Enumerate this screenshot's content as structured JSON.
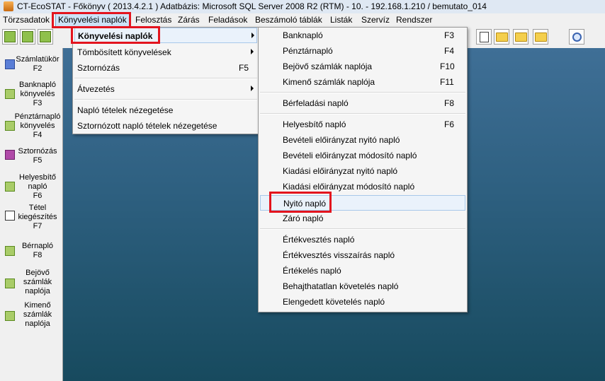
{
  "window": {
    "title": "CT-EcoSTAT - Főkönyv ( 2013.4.2.1 ) Adatbázis: Microsoft SQL Server 2008 R2 (RTM) - 10. - 192.168.1.210 / bemutato_014"
  },
  "menubar": {
    "items": [
      {
        "label": "Törzsadatok"
      },
      {
        "label": "Könyvelési naplók"
      },
      {
        "label": "Felosztás"
      },
      {
        "label": "Zárás"
      },
      {
        "label": "Feladások"
      },
      {
        "label": "Beszámoló táblák"
      },
      {
        "label": "Listák"
      },
      {
        "label": "Szervíz"
      },
      {
        "label": "Rendszer"
      }
    ]
  },
  "sidebar": {
    "items": [
      {
        "label": "Számlatükör\nF2"
      },
      {
        "label": "Banknapló\nkönyvelés\nF3"
      },
      {
        "label": "Pénztárnapló\nkönyvelés\nF4"
      },
      {
        "label": "Sztornózás\nF5"
      },
      {
        "label": "Helyesbítő\nnapló\nF6"
      },
      {
        "label": "Tétel\nkiegészítés\nF7"
      },
      {
        "label": "Bérnapló\nF8"
      },
      {
        "label": "Bejövő\nszámlák\nnaplója"
      },
      {
        "label": "Kimenő\nszámlák\nnaplója"
      }
    ]
  },
  "menu1": {
    "items": [
      {
        "label": "Könyvelési naplók",
        "shortcut": ""
      },
      {
        "label": "Tömbösített könyvelések",
        "shortcut": ""
      },
      {
        "label": "Sztornózás",
        "shortcut": "F5"
      },
      {
        "label": "Átvezetés",
        "shortcut": ""
      },
      {
        "label": "Napló tételek nézegetése",
        "shortcut": ""
      },
      {
        "label": "Sztornózott napló tételek nézegetése",
        "shortcut": ""
      }
    ]
  },
  "menu2": {
    "items": [
      {
        "label": "Banknapló",
        "shortcut": "F3"
      },
      {
        "label": "Pénztárnapló",
        "shortcut": "F4"
      },
      {
        "label": "Bejövő számlák naplója",
        "shortcut": "F10"
      },
      {
        "label": "Kimenő számlák naplója",
        "shortcut": "F11"
      },
      {
        "label": "Bérfeladási napló",
        "shortcut": "F8"
      },
      {
        "label": "Helyesbítő napló",
        "shortcut": "F6"
      },
      {
        "label": "Bevételi előirányzat nyitó napló",
        "shortcut": ""
      },
      {
        "label": "Bevételi előirányzat módosító napló",
        "shortcut": ""
      },
      {
        "label": "Kiadási előirányzat nyitó napló",
        "shortcut": ""
      },
      {
        "label": "Kiadási előirányzat módosító napló",
        "shortcut": ""
      },
      {
        "label": "Nyitó napló",
        "shortcut": ""
      },
      {
        "label": "Záró napló",
        "shortcut": ""
      },
      {
        "label": "Értékvesztés napló",
        "shortcut": ""
      },
      {
        "label": "Értékvesztés visszaírás napló",
        "shortcut": ""
      },
      {
        "label": "Értékelés napló",
        "shortcut": ""
      },
      {
        "label": "Behajthatatlan követelés napló",
        "shortcut": ""
      },
      {
        "label": "Elengedett követelés napló",
        "shortcut": ""
      }
    ]
  },
  "colors": {
    "highlight_box": "#e3141e",
    "desktop": "#2d5f7f"
  }
}
